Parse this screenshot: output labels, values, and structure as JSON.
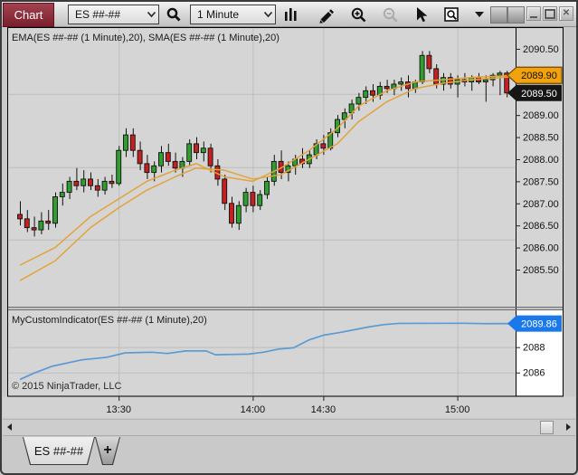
{
  "titlebar": {
    "chart_tab_label": "Chart",
    "instrument_value": "ES ##-##",
    "interval_value": "1 Minute"
  },
  "tabs": {
    "active_tab_label": "ES ##-##",
    "add_tab_label": "+"
  },
  "colors": {
    "chart_bg": "#d5d5d5",
    "grid": "#bdbdbd",
    "candle_up": "#2f9e2f",
    "candle_down": "#c42020",
    "ma_line": "#e2a33b",
    "indicator_line": "#5b9bd5",
    "marker_orange": "#f2a20d",
    "marker_black": "#161616",
    "marker_blue": "#1a78e8"
  },
  "chart_data": [
    {
      "type": "candlestick",
      "panel": "price",
      "label": "EMA(ES ##-## (1 Minute),20), SMA(ES ##-## (1 Minute),20)",
      "ylim": [
        2084.66,
        2090.97
      ],
      "y_ticks": [
        {
          "v": 2090.5,
          "label": "2090.50"
        },
        {
          "v": 2089.0,
          "label": "2089.00"
        },
        {
          "v": 2088.5,
          "label": "2088.50"
        },
        {
          "v": 2088.0,
          "label": "2088.00"
        },
        {
          "v": 2087.5,
          "label": "2087.50"
        },
        {
          "v": 2087.0,
          "label": "2087.00"
        },
        {
          "v": 2086.5,
          "label": "2086.50"
        },
        {
          "v": 2086.0,
          "label": "2086.00"
        },
        {
          "v": 2085.5,
          "label": "2085.50"
        }
      ],
      "y_grid": [
        2089.48,
        2087.82,
        2086.18
      ],
      "x_ticks": [
        {
          "bar": 14,
          "label": "13:30"
        },
        {
          "bar": 33,
          "label": "14:00"
        },
        {
          "bar": 43,
          "label": "14:30"
        },
        {
          "bar": 62,
          "label": "15:00"
        }
      ],
      "price_markers": [
        {
          "price": 2089.9,
          "label": "2089.90",
          "fill": "#f2a20d",
          "text": "#111111",
          "stroke": "#6b4a00"
        },
        {
          "price": 2089.5,
          "label": "2089.50",
          "fill": "#161616",
          "text": "#ffffff",
          "stroke": "none"
        }
      ],
      "candles": [
        [
          2086.75,
          2087.05,
          2086.5,
          2086.65
        ],
        [
          2086.65,
          2086.85,
          2086.35,
          2086.45
        ],
        [
          2086.45,
          2086.7,
          2086.25,
          2086.4
        ],
        [
          2086.4,
          2086.8,
          2086.3,
          2086.6
        ],
        [
          2086.6,
          2086.85,
          2086.4,
          2086.55
        ],
        [
          2086.55,
          2087.25,
          2086.45,
          2087.15
        ],
        [
          2087.15,
          2087.45,
          2086.95,
          2087.25
        ],
        [
          2087.25,
          2087.6,
          2087.1,
          2087.5
        ],
        [
          2087.5,
          2087.8,
          2087.3,
          2087.4
        ],
        [
          2087.4,
          2087.75,
          2087.25,
          2087.55
        ],
        [
          2087.55,
          2087.7,
          2087.3,
          2087.4
        ],
        [
          2087.4,
          2087.55,
          2087.15,
          2087.3
        ],
        [
          2087.3,
          2087.6,
          2087.2,
          2087.5
        ],
        [
          2087.5,
          2087.65,
          2087.35,
          2087.45
        ],
        [
          2087.45,
          2088.3,
          2087.4,
          2088.2
        ],
        [
          2088.2,
          2088.7,
          2088.05,
          2088.55
        ],
        [
          2088.55,
          2088.7,
          2088.05,
          2088.2
        ],
        [
          2088.2,
          2088.4,
          2087.75,
          2087.9
        ],
        [
          2087.9,
          2088.1,
          2087.55,
          2087.7
        ],
        [
          2087.7,
          2087.95,
          2087.5,
          2087.85
        ],
        [
          2087.85,
          2088.3,
          2087.7,
          2088.15
        ],
        [
          2088.15,
          2088.35,
          2087.85,
          2087.95
        ],
        [
          2087.95,
          2088.15,
          2087.7,
          2087.8
        ],
        [
          2087.8,
          2088.05,
          2087.6,
          2087.95
        ],
        [
          2087.95,
          2088.45,
          2087.85,
          2088.35
        ],
        [
          2088.35,
          2088.5,
          2088.0,
          2088.15
        ],
        [
          2088.15,
          2088.4,
          2087.95,
          2088.25
        ],
        [
          2088.25,
          2088.35,
          2087.7,
          2087.85
        ],
        [
          2087.85,
          2088.0,
          2087.4,
          2087.55
        ],
        [
          2087.55,
          2087.65,
          2086.85,
          2087.0
        ],
        [
          2087.0,
          2087.15,
          2086.45,
          2086.55
        ],
        [
          2086.55,
          2087.05,
          2086.4,
          2086.95
        ],
        [
          2086.95,
          2087.35,
          2086.8,
          2087.25
        ],
        [
          2087.25,
          2087.4,
          2086.8,
          2086.95
        ],
        [
          2086.95,
          2087.3,
          2086.85,
          2087.2
        ],
        [
          2087.2,
          2087.6,
          2087.1,
          2087.5
        ],
        [
          2087.5,
          2088.1,
          2087.4,
          2087.95
        ],
        [
          2087.95,
          2088.2,
          2087.55,
          2087.7
        ],
        [
          2087.7,
          2087.95,
          2087.5,
          2087.85
        ],
        [
          2087.85,
          2088.1,
          2087.65,
          2088.0
        ],
        [
          2088.0,
          2088.25,
          2087.8,
          2087.9
        ],
        [
          2087.9,
          2088.2,
          2087.8,
          2088.1
        ],
        [
          2088.1,
          2088.45,
          2088.0,
          2088.35
        ],
        [
          2088.35,
          2088.55,
          2088.1,
          2088.25
        ],
        [
          2088.25,
          2088.7,
          2088.2,
          2088.6
        ],
        [
          2088.6,
          2089.0,
          2088.5,
          2088.9
        ],
        [
          2088.9,
          2089.15,
          2088.7,
          2089.05
        ],
        [
          2089.05,
          2089.35,
          2088.9,
          2089.25
        ],
        [
          2089.25,
          2089.5,
          2089.1,
          2089.4
        ],
        [
          2089.4,
          2089.65,
          2089.25,
          2089.55
        ],
        [
          2089.55,
          2089.7,
          2089.3,
          2089.45
        ],
        [
          2089.45,
          2089.75,
          2089.35,
          2089.65
        ],
        [
          2089.65,
          2089.8,
          2089.5,
          2089.6
        ],
        [
          2089.6,
          2089.8,
          2089.45,
          2089.7
        ],
        [
          2089.7,
          2089.85,
          2089.55,
          2089.75
        ],
        [
          2089.75,
          2089.9,
          2089.4,
          2089.6
        ],
        [
          2089.6,
          2089.8,
          2089.5,
          2089.75
        ],
        [
          2089.75,
          2090.45,
          2089.7,
          2090.35
        ],
        [
          2090.35,
          2090.45,
          2089.95,
          2090.05
        ],
        [
          2090.05,
          2090.15,
          2089.6,
          2089.7
        ],
        [
          2089.7,
          2089.95,
          2089.55,
          2089.85
        ],
        [
          2089.85,
          2089.95,
          2089.6,
          2089.7
        ],
        [
          2089.7,
          2089.9,
          2089.4,
          2089.8
        ],
        [
          2089.8,
          2089.95,
          2089.65,
          2089.75
        ],
        [
          2089.75,
          2089.9,
          2089.55,
          2089.85
        ],
        [
          2089.85,
          2089.95,
          2089.7,
          2089.75
        ],
        [
          2089.75,
          2089.9,
          2089.3,
          2089.8
        ],
        [
          2089.8,
          2089.95,
          2089.65,
          2089.9
        ],
        [
          2089.9,
          2090.0,
          2089.45,
          2089.95
        ],
        [
          2089.95,
          2090.0,
          2089.4,
          2089.5
        ]
      ],
      "overlays": [
        {
          "name": "EMA(20)",
          "color": "#e2a33b",
          "points": [
            [
              0,
              2085.6
            ],
            [
              5,
              2086.0
            ],
            [
              10,
              2086.7
            ],
            [
              14,
              2087.1
            ],
            [
              18,
              2087.5
            ],
            [
              22,
              2087.75
            ],
            [
              25,
              2087.9
            ],
            [
              29,
              2087.6
            ],
            [
              33,
              2087.5
            ],
            [
              37,
              2087.8
            ],
            [
              41,
              2088.2
            ],
            [
              45,
              2088.7
            ],
            [
              48,
              2089.2
            ],
            [
              52,
              2089.55
            ],
            [
              56,
              2089.75
            ],
            [
              60,
              2089.8
            ],
            [
              64,
              2089.85
            ],
            [
              70,
              2089.9
            ]
          ]
        },
        {
          "name": "SMA(20)",
          "color": "#e2a33b",
          "points": [
            [
              0,
              2085.25
            ],
            [
              5,
              2085.7
            ],
            [
              10,
              2086.45
            ],
            [
              14,
              2086.9
            ],
            [
              18,
              2087.3
            ],
            [
              22,
              2087.6
            ],
            [
              25,
              2087.8
            ],
            [
              29,
              2087.75
            ],
            [
              33,
              2087.55
            ],
            [
              37,
              2087.65
            ],
            [
              41,
              2088.0
            ],
            [
              45,
              2088.35
            ],
            [
              48,
              2088.85
            ],
            [
              52,
              2089.3
            ],
            [
              56,
              2089.6
            ],
            [
              60,
              2089.72
            ],
            [
              64,
              2089.8
            ],
            [
              70,
              2089.87
            ]
          ]
        }
      ]
    },
    {
      "type": "line",
      "panel": "indicator",
      "label": "MyCustomIndicator(ES ##-## (1 Minute),20)",
      "ylim": [
        2084.2,
        2090.9
      ],
      "y_ticks": [
        {
          "v": 2088,
          "label": "2088"
        },
        {
          "v": 2086,
          "label": "2086"
        }
      ],
      "y_grid": [
        2088,
        2086
      ],
      "series": [
        {
          "name": "MyCustomIndicator",
          "color": "#5b9bd5",
          "points": [
            [
              0,
              2085.45
            ],
            [
              2,
              2085.95
            ],
            [
              4.6,
              2086.5
            ],
            [
              8.8,
              2087.0
            ],
            [
              12.3,
              2087.2
            ],
            [
              14.9,
              2087.55
            ],
            [
              18.7,
              2087.6
            ],
            [
              20.9,
              2087.5
            ],
            [
              23.5,
              2087.7
            ],
            [
              26.4,
              2087.7
            ],
            [
              27.7,
              2087.4
            ],
            [
              32.4,
              2087.45
            ],
            [
              34.5,
              2087.6
            ],
            [
              36.7,
              2087.85
            ],
            [
              38.8,
              2087.95
            ],
            [
              40.9,
              2088.55
            ],
            [
              43.1,
              2088.95
            ],
            [
              45.3,
              2089.15
            ],
            [
              49.5,
              2089.6
            ],
            [
              51.7,
              2089.78
            ],
            [
              53.7,
              2089.87
            ],
            [
              63,
              2089.88
            ],
            [
              66,
              2089.85
            ],
            [
              70,
              2089.86
            ]
          ]
        }
      ],
      "price_markers": [
        {
          "price": 2089.86,
          "label": "2089.86",
          "fill": "#1a78e8",
          "text": "#ffffff",
          "stroke": "none"
        }
      ],
      "copyright": "© 2015 NinjaTrader, LLC"
    }
  ]
}
